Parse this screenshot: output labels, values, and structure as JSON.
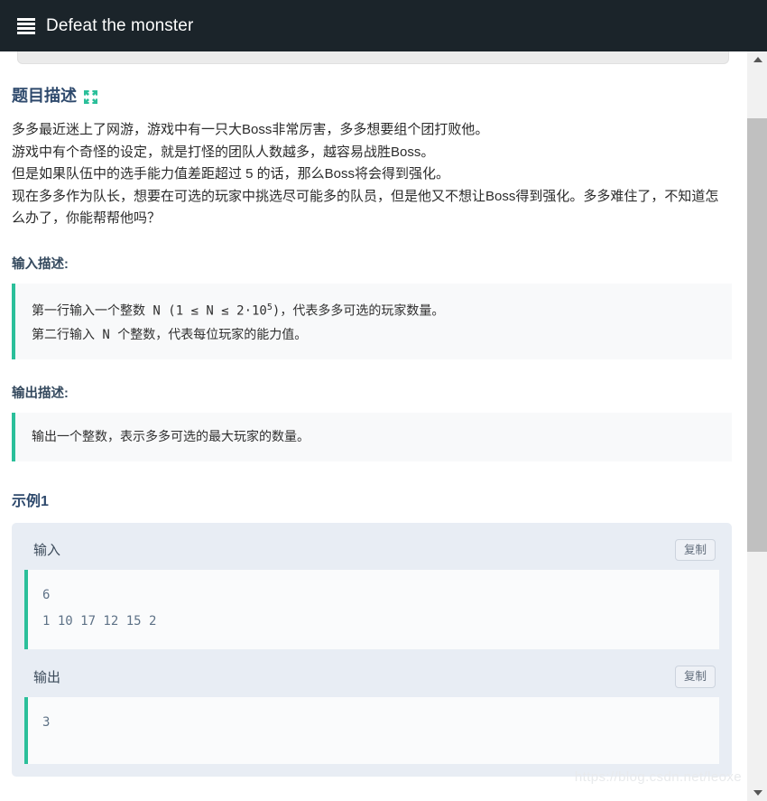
{
  "header": {
    "icon": "list-icon",
    "title": "Defeat the monster"
  },
  "section": {
    "title": "题目描述",
    "expand_icon": "expand-arrows-icon",
    "description_lines": [
      "多多最近迷上了网游，游戏中有一只大Boss非常厉害，多多想要组个团打败他。",
      "游戏中有个奇怪的设定，就是打怪的团队人数越多，越容易战胜Boss。",
      "但是如果队伍中的选手能力值差距超过 5 的话，那么Boss将会得到强化。",
      "现在多多作为队长，想要在可选的玩家中挑选尽可能多的队员，但是他又不想让Boss得到强化。多多难住了，不知道怎么办了，你能帮帮他吗？"
    ]
  },
  "input_description": {
    "heading": "输入描述:",
    "line1_prefix": "第一行输入一个整数 N (1 ≤ N ≤ 2·10",
    "line1_sup": "5",
    "line1_suffix": ")，代表多多可选的玩家数量。",
    "line2": "第二行输入 N 个整数，代表每位玩家的能力值。"
  },
  "output_description": {
    "heading": "输出描述:",
    "text": "输出一个整数，表示多多可选的最大玩家的数量。"
  },
  "example": {
    "title": "示例1",
    "input_label": "输入",
    "input_copy_label": "复制",
    "input_code": "6\n1 10 17 12 15 2",
    "output_label": "输出",
    "output_copy_label": "复制",
    "output_code": "3"
  },
  "watermark": "https://blog.csdn.net/leoxe",
  "scrollbar": {
    "up_arrow": "chevron-up-icon",
    "down_arrow": "chevron-down-icon"
  },
  "colors": {
    "topbar_bg": "#1b242a",
    "accent_teal": "#2bbf9a",
    "heading_blue": "#2f4a6d",
    "example_bg": "#e8edf4",
    "code_text": "#5e7287"
  }
}
